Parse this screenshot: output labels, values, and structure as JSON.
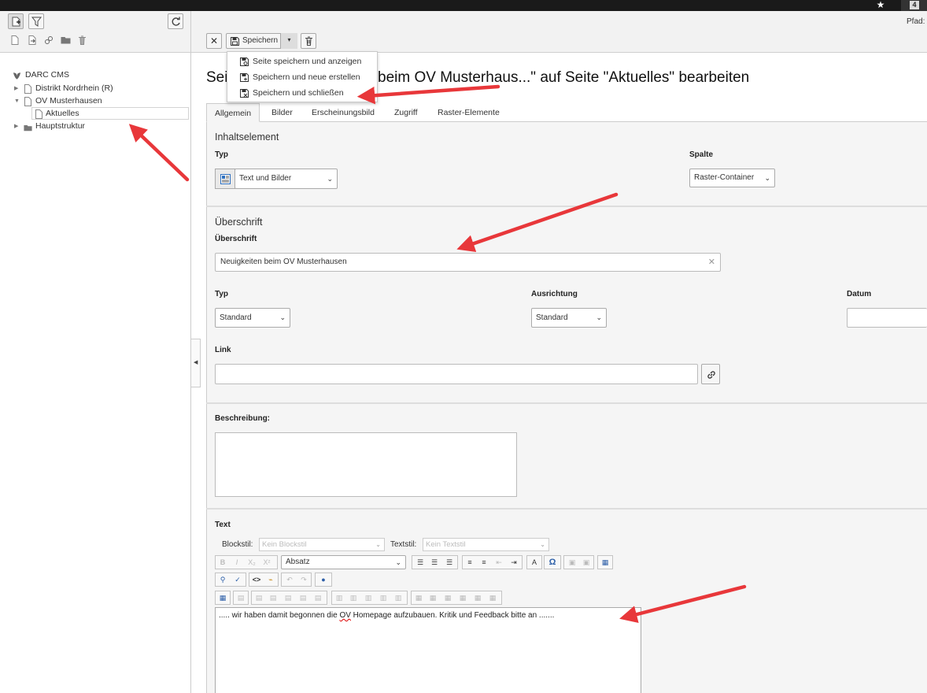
{
  "topbar": {
    "badge_count": "4"
  },
  "header": {
    "pfad_label": "Pfad:"
  },
  "tree": {
    "root": "DARC CMS",
    "items": [
      {
        "label": "Distrikt Nordrhein (R)"
      },
      {
        "label": "OV Musterhausen"
      },
      {
        "label": "Aktuelles"
      },
      {
        "label": "Hauptstruktur"
      }
    ]
  },
  "toolbar": {
    "save_label": "Speichern",
    "save_menu": [
      "Seite speichern und anzeigen",
      "Speichern und neue erstellen",
      "Speichern und schließen"
    ]
  },
  "page": {
    "title_start": "Sei",
    "title_end": " beim OV Musterhaus...\" auf Seite \"Aktuelles\" bearbeiten"
  },
  "tabs": [
    "Allgemein",
    "Bilder",
    "Erscheinungsbild",
    "Zugriff",
    "Raster-Elemente"
  ],
  "content_element": {
    "section_title": "Inhaltselement",
    "typ_label": "Typ",
    "typ_value": "Text und Bilder",
    "spalte_label": "Spalte",
    "spalte_value": "Raster-Container"
  },
  "heading_section": {
    "section_title": "Überschrift",
    "heading_label": "Überschrift",
    "heading_value": "Neuigkeiten beim OV Musterhausen",
    "typ_label": "Typ",
    "typ_value": "Standard",
    "ausrichtung_label": "Ausrichtung",
    "ausrichtung_value": "Standard",
    "datum_label": "Datum",
    "link_label": "Link",
    "beschreibung_label": "Beschreibung:"
  },
  "text_section": {
    "label": "Text",
    "blockstil_label": "Blockstil:",
    "blockstil_value": "Kein Blockstil",
    "textstil_label": "Textstil:",
    "textstil_value": "Kein Textstil",
    "format_value": "Absatz",
    "content_before": "..... wir haben damit begonnen die ",
    "content_misspelled": "OV",
    "content_after": " Homepage aufzubauen. Kritik und Feedback bitte an ......."
  },
  "colors": {
    "arrow": "#e8373a",
    "panel_bg": "#f5f5f5",
    "topbar": "#1a1a1a"
  }
}
